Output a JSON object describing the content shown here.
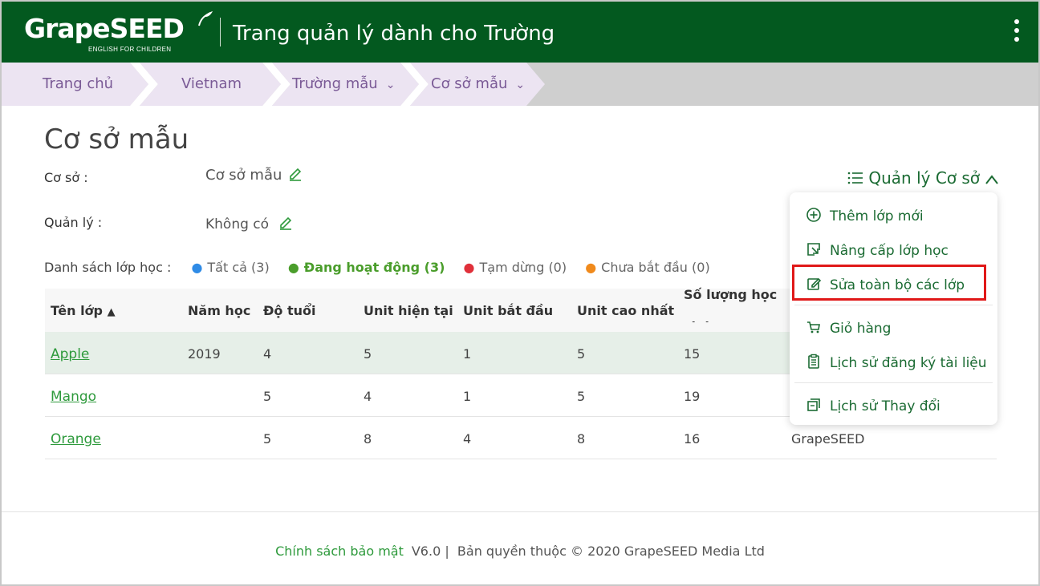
{
  "header": {
    "logo_text": "GrapeSEED",
    "logo_tagline": "ENGLISH FOR CHILDREN",
    "title": "Trang quản lý dành cho Trường"
  },
  "breadcrumb": [
    {
      "label": "Trang chủ",
      "has_dropdown": false
    },
    {
      "label": "Vietnam",
      "has_dropdown": false
    },
    {
      "label": "Trường mẫu",
      "has_dropdown": true
    },
    {
      "label": "Cơ sở mẫu",
      "has_dropdown": true
    }
  ],
  "page": {
    "title": "Cơ sở mẫu",
    "campus_label": "Cơ sở :",
    "campus_value": "Cơ sở mẫu",
    "manager_label": "Quản lý :",
    "manager_value": "Không có",
    "manage_button": "Quản lý Cơ sở"
  },
  "filters": {
    "label": "Danh sách lớp học :",
    "items": [
      {
        "label": "Tất cả",
        "count": "(3)",
        "color": "#2f8be6",
        "active": false
      },
      {
        "label": "Đang hoạt động",
        "count": "(3)",
        "color": "#4a9d2b",
        "active": true
      },
      {
        "label": "Tạm dừng",
        "count": "(0)",
        "color": "#e0303a",
        "active": false
      },
      {
        "label": "Chưa bắt đầu",
        "count": "(0)",
        "color": "#f08a1c",
        "active": false
      }
    ]
  },
  "table": {
    "columns": [
      "Tên lớp",
      "Năm học",
      "Độ tuổi",
      "Unit hiện tại",
      "Unit bắt đầu",
      "Unit cao nhất",
      "Số lượng học sinh"
    ],
    "sort_indicator": "▲",
    "rows": [
      {
        "name": "Apple",
        "year": "2019",
        "age": "4",
        "current_unit": "5",
        "start_unit": "1",
        "max_unit": "5",
        "students": "15",
        "extra": ""
      },
      {
        "name": "Mango",
        "year": "",
        "age": "5",
        "current_unit": "4",
        "start_unit": "1",
        "max_unit": "5",
        "students": "19",
        "extra": ""
      },
      {
        "name": "Orange",
        "year": "",
        "age": "5",
        "current_unit": "8",
        "start_unit": "4",
        "max_unit": "8",
        "students": "16",
        "extra": "GrapeSEED"
      }
    ]
  },
  "menu": {
    "items": [
      {
        "label": "Thêm lớp mới",
        "icon": "plus-circle-icon"
      },
      {
        "label": "Nâng cấp lớp học",
        "icon": "upgrade-icon"
      },
      {
        "label": "Sửa toàn bộ các lớp",
        "icon": "edit-icon"
      },
      {
        "label": "Giỏ hàng",
        "icon": "cart-icon"
      },
      {
        "label": "Lịch sử đăng ký tài liệu",
        "icon": "clipboard-icon"
      },
      {
        "label": "Lịch sử Thay đổi",
        "icon": "history-icon"
      }
    ]
  },
  "footer": {
    "policy": "Chính sách bảo mật",
    "version": "V6.0 |",
    "copyright": "Bản quyền thuộc © 2020 GrapeSEED Media Ltd"
  }
}
